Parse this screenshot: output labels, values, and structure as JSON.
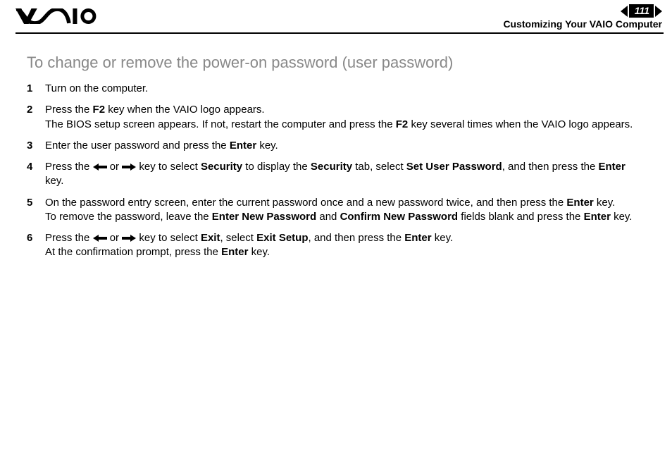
{
  "header": {
    "logo_name": "VAIO",
    "page_number": "111",
    "section": "Customizing Your VAIO Computer"
  },
  "title": "To change or remove the power-on password (user password)",
  "steps": {
    "s1": {
      "n": "1",
      "t": "Turn on the computer."
    },
    "s2": {
      "n": "2",
      "a": "Press the ",
      "b": "F2",
      "c": " key when the VAIO logo appears.",
      "d": "The BIOS setup screen appears. If not, restart the computer and press the ",
      "e": "F2",
      "f": " key several times when the VAIO logo appears."
    },
    "s3": {
      "n": "3",
      "a": "Enter the user password and press the ",
      "b": "Enter",
      "c": " key."
    },
    "s4": {
      "n": "4",
      "a": "Press the ",
      "b": " or ",
      "c": " key to select ",
      "d": "Security",
      "e": " to display the ",
      "f": "Security",
      "g": " tab, select ",
      "h": "Set User Password",
      "i": ", and then press the ",
      "j": "Enter",
      "k": " key."
    },
    "s5": {
      "n": "5",
      "a": "On the password entry screen, enter the current password once and a new password twice, and then press the ",
      "b": "Enter",
      "c": " key.",
      "d": "To remove the password, leave the ",
      "e": "Enter New Password",
      "f": " and ",
      "g": "Confirm New Password",
      "h": " fields blank and press the ",
      "i": "Enter",
      "j": " key."
    },
    "s6": {
      "n": "6",
      "a": "Press the ",
      "b": " or ",
      "c": " key to select ",
      "d": "Exit",
      "e": ", select ",
      "f": "Exit Setup",
      "g": ", and then press the ",
      "h": "Enter",
      "i": " key.",
      "j": "At the confirmation prompt, press the ",
      "k": "Enter",
      "l": " key."
    }
  }
}
